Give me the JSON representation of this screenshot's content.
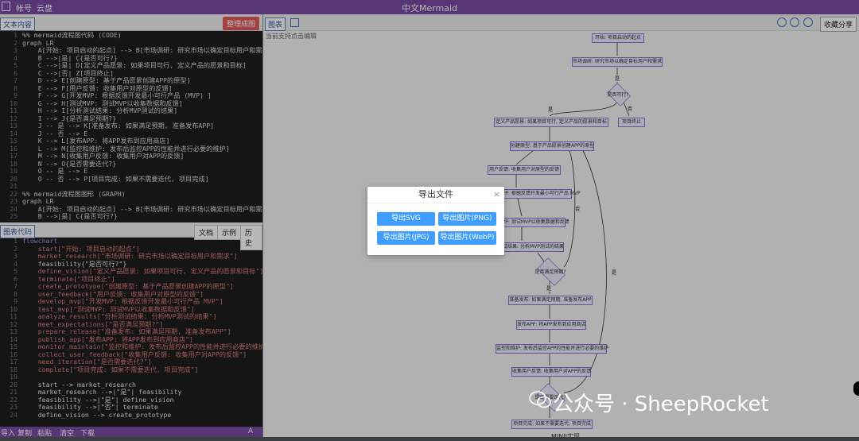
{
  "topbar": {
    "menu_account": "帐号",
    "menu_cloud": "云盘",
    "app_title": "中文Mermaid"
  },
  "left_top": {
    "tab_label": "文本内容",
    "action_label": "整理成图"
  },
  "code_top": [
    [
      "1",
      "%% mermaid流程图代码 (CODE)"
    ],
    [
      "2",
      "graph LR"
    ],
    [
      "3",
      "    A[开始: 项目启动的起点] --> B[市场调研: 研究市场以确定目标用户和需求]"
    ],
    [
      "4",
      "    B -->|是| C{是否可行?}"
    ],
    [
      "5",
      "    C -->|是| D[定义产品愿景: 如果项目可行, 定义产品的愿景和目标]"
    ],
    [
      "6",
      "    C -->|否| Z[项目终止]"
    ],
    [
      "7",
      "    D --> E[创建原型: 基于产品愿景创建APP的原型]"
    ],
    [
      "8",
      "    E --> F[用户反馈: 收集用户对原型的反馈]"
    ],
    [
      "9",
      "    F --> G[开发MVP: 根据反馈开发最小可行产品 (MVP) ]"
    ],
    [
      "10",
      "    G --> H[测试MVP: 测试MVP以收集数据和反馈]"
    ],
    [
      "11",
      "    H --> I[分析测试结果: 分析MVP测试的结果]"
    ],
    [
      "12",
      "    I --> J{是否满足预期?}"
    ],
    [
      "13",
      "    J -- 是 --> K[准备发布: 如果满足预期, 准备发布APP]"
    ],
    [
      "14",
      "    J -- 否 --> E"
    ],
    [
      "15",
      "    K --> L[发布APP: 将APP发布到应用商店]"
    ],
    [
      "16",
      "    L --> M[监控和维护: 发布后监控APP的性能并进行必要的维护]"
    ],
    [
      "17",
      "    M --> N[收集用户反馈: 收集用户对APP的反馈]"
    ],
    [
      "18",
      "    N --> O{是否需要迭代?}"
    ],
    [
      "19",
      "    O -- 是 --> E"
    ],
    [
      "20",
      "    O -- 否 --> P[项目完成: 如果不需要迭代, 项目完成]"
    ],
    [
      "21",
      ""
    ],
    [
      "22",
      "%% mermaid流程图图形 (GRAPH)"
    ],
    [
      "23",
      "graph LR"
    ],
    [
      "24",
      "    A[开始: 项目启动的起点] --> B[市场调研: 研究市场以确定目标用户和需求]"
    ],
    [
      "25",
      "    B -->|是| C{是否可行?}"
    ]
  ],
  "left_mid": {
    "tab_label": "图表代码",
    "btn_doc": "文档",
    "btn_example": "示例",
    "btn_history": "历史"
  },
  "code_bottom": [
    [
      "1",
      "flowchart"
    ],
    [
      "2",
      "    start[\"开始: 项目启动的起点\"]"
    ],
    [
      "3",
      "    market_research[\"市场调研: 研究市场以确定目标用户和需求\"]"
    ],
    [
      "4",
      "    feasibility{\"是否可行?\"}"
    ],
    [
      "5",
      "    define_vision[\"定义产品愿景: 如果项目可行, 定义产品的愿景和目标\"]"
    ],
    [
      "6",
      "    terminate[\"项目终止\"]"
    ],
    [
      "7",
      "    create_prototype[\"创建原型: 基于产品愿景创建APP的原型\"]"
    ],
    [
      "8",
      "    user_feedback[\"用户反馈: 收集用户对原型的反馈\"]"
    ],
    [
      "9",
      "    develop_mvp[\"开发MVP: 根据反馈开发最小可行产品 MVP\"]"
    ],
    [
      "10",
      "    test_mvp[\"测试MVP: 测试MVP以收集数据和反馈\"]"
    ],
    [
      "11",
      "    analyze_results[\"分析测试结果: 分析MVP测试的结果\"]"
    ],
    [
      "12",
      "    meet_expectations[\"是否满足预期?\"]"
    ],
    [
      "13",
      "    prepare_release[\"准备发布: 如果满足预期, 准备发布APP\"]"
    ],
    [
      "14",
      "    publish_app[\"发布APP: 将APP发布到应用商店\"]"
    ],
    [
      "15",
      "    monitor_maintain[\"监控和维护: 发布后监控APP的性能并进行必要的维护\"]"
    ],
    [
      "16",
      "    collect_user_feedback[\"收集用户反馈: 收集用户对APP的反馈\"]"
    ],
    [
      "17",
      "    need_iteration[\"是否需要迭代?\"]"
    ],
    [
      "18",
      "    complete[\"项目完成: 如果不需要迭代, 项目完成\"]"
    ],
    [
      "19",
      ""
    ],
    [
      "20",
      "    start --> market_research"
    ],
    [
      "21",
      "    market_research -->|\"是\"| feasibility"
    ],
    [
      "22",
      "    feasibility -->|\"是\"| define_vision"
    ],
    [
      "23",
      "    feasibility -->|\"否\"| terminate"
    ],
    [
      "24",
      "    define_vision --> create_prototype"
    ]
  ],
  "bottom_bar": {
    "import": "导入",
    "copy": "复制",
    "paste": "粘贴",
    "clear": "清空",
    "download": "下载",
    "font": "A"
  },
  "right": {
    "tab_label": "图表",
    "share_label": "收藏分享",
    "tip": "当前支持点击编辑"
  },
  "diagram": {
    "nodes": {
      "start": "开始: 项目启动的起点",
      "market": "市场调研: 研究市场以确定目标用户和需求",
      "feasible": "是否可行?",
      "vision": "定义产品愿景: 如果项目可行, 定义产品的愿景和目标",
      "terminate": "项目终止",
      "prototype": "创建原型: 基于产品愿景创建APP的原型",
      "feedback": "用户反馈: 收集用户对原型的反馈",
      "mvp": "开发MVP: 根据反馈开发最小可行产品 MVP",
      "test": "测试MVP: 测试MVP以收集数据和反馈",
      "analyze": "分析测试结果: 分析MVP测试的结果",
      "meet": "是否满足预期?",
      "prepare": "准备发布: 如果满足预期, 准备发布APP",
      "publish": "发布APP: 将APP发布到应用商店",
      "monitor": "监控和维护: 发布后监控APP的性能并进行必要的维护",
      "collect": "收集用户反馈: 收集用户对APP的反馈",
      "iterate": "是否需要迭代?",
      "complete": "项目完成: 如果不需要迭代, 项目完成"
    },
    "edge_yes": "是",
    "edge_no": "否",
    "footer": "MINJI实现"
  },
  "modal": {
    "title": "导出文件",
    "close": "×",
    "btn_svg": "导出SVG",
    "btn_png": "导出图片(PNG)",
    "btn_jpg": "导出图片(JPG)",
    "btn_webp": "导出图片(WebP)"
  },
  "watermark": {
    "text": "公众号 · SheepRocket"
  },
  "colors": {
    "accent": "#7b4aa3",
    "button_blue": "#409eff",
    "danger": "#e05a5a"
  }
}
